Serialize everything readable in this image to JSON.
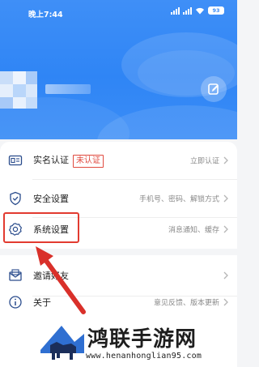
{
  "status_bar": {
    "time": "晚上7:44",
    "battery": "93"
  },
  "profile": {
    "edit_icon": "edit-pencil-icon"
  },
  "menu": {
    "realname": {
      "label": "实名认证",
      "badge": "未认证",
      "action": "立即认证"
    },
    "security": {
      "label": "安全设置",
      "detail": "手机号、密码、解锁方式"
    },
    "system": {
      "label": "系统设置",
      "detail": "消息通知、缓存"
    },
    "invite": {
      "label": "邀请好友"
    },
    "about": {
      "label": "关于",
      "detail": "意见反馈、版本更新"
    }
  },
  "watermark": {
    "title": "鸿联手游网",
    "url": "www.henanhonglian95.com"
  },
  "colors": {
    "header_blue": "#3a8bf6",
    "highlight_red": "#e23b30",
    "badge_red": "#e04a3f"
  }
}
